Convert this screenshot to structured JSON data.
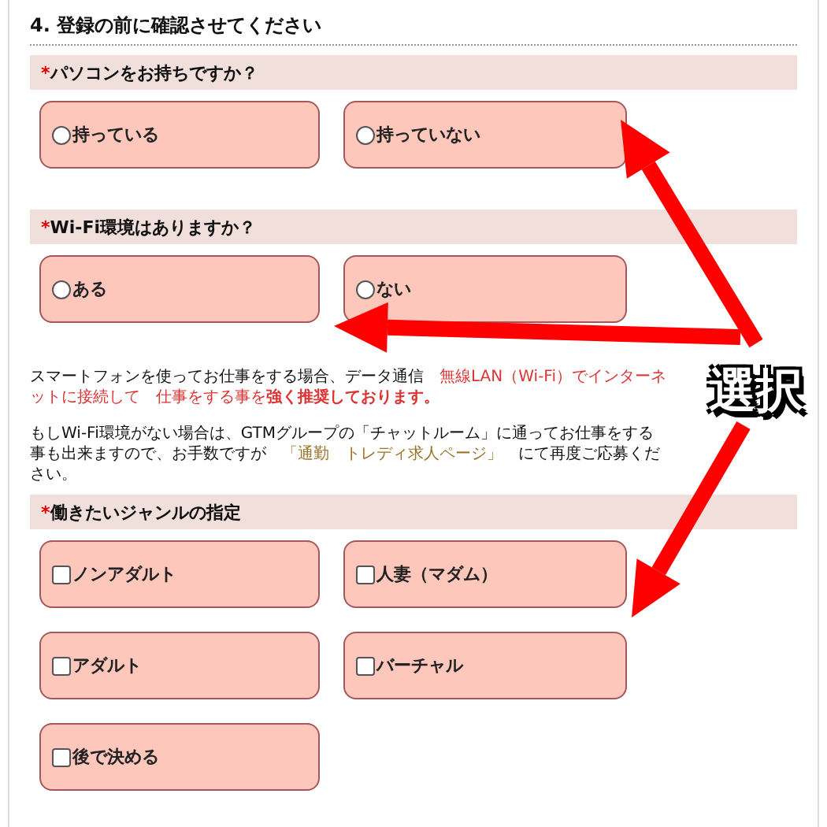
{
  "section_title": "4. 登録の前に確認させてください",
  "blocks": [
    {
      "kind": "radio",
      "required_mark": "*",
      "question": "パソコンをお持ちですか？",
      "options": [
        {
          "label": "持っている",
          "selected": false
        },
        {
          "label": "持っていない",
          "selected": false
        }
      ]
    },
    {
      "kind": "radio",
      "required_mark": "*",
      "question": "Wi-Fi環境はありますか？",
      "options": [
        {
          "label": "ある",
          "selected": false
        },
        {
          "label": "ない",
          "selected": false
        }
      ]
    },
    {
      "kind": "notes",
      "paragraphs": [
        [
          {
            "kind": "plain",
            "text": "スマートフォンを使ってお仕事をする場合、データ通信"
          },
          {
            "kind": "red",
            "text": "無線LAN（Wi-Fi）でインターネットに接続して"
          },
          {
            "kind": "red",
            "text": "仕事をする事を**強く推奨しております。**"
          }
        ],
        [
          {
            "kind": "plain",
            "text": "もしWi-Fi環境がない場合は、GTMグループの「チャットルーム」に通ってお仕事をする事も出来ますので、お手数ですが"
          },
          {
            "kind": "link",
            "text": "「通勤"
          },
          {
            "kind": "link",
            "text": "トレディ求人ページ」"
          },
          {
            "kind": "plain",
            "text": "にて再度ご応募ください。"
          }
        ]
      ]
    },
    {
      "kind": "checkbox",
      "required_mark": "*",
      "question": "働きたいジャンルの指定",
      "options": [
        {
          "label": "ノンアダルト",
          "checked": false
        },
        {
          "label": "人妻（マダム）",
          "checked": false
        },
        {
          "label": "アダルト",
          "checked": false
        },
        {
          "label": "バーチャル",
          "checked": false
        },
        {
          "label": "後で決める",
          "checked": false
        }
      ]
    }
  ],
  "annotation": {
    "label": "選択"
  }
}
